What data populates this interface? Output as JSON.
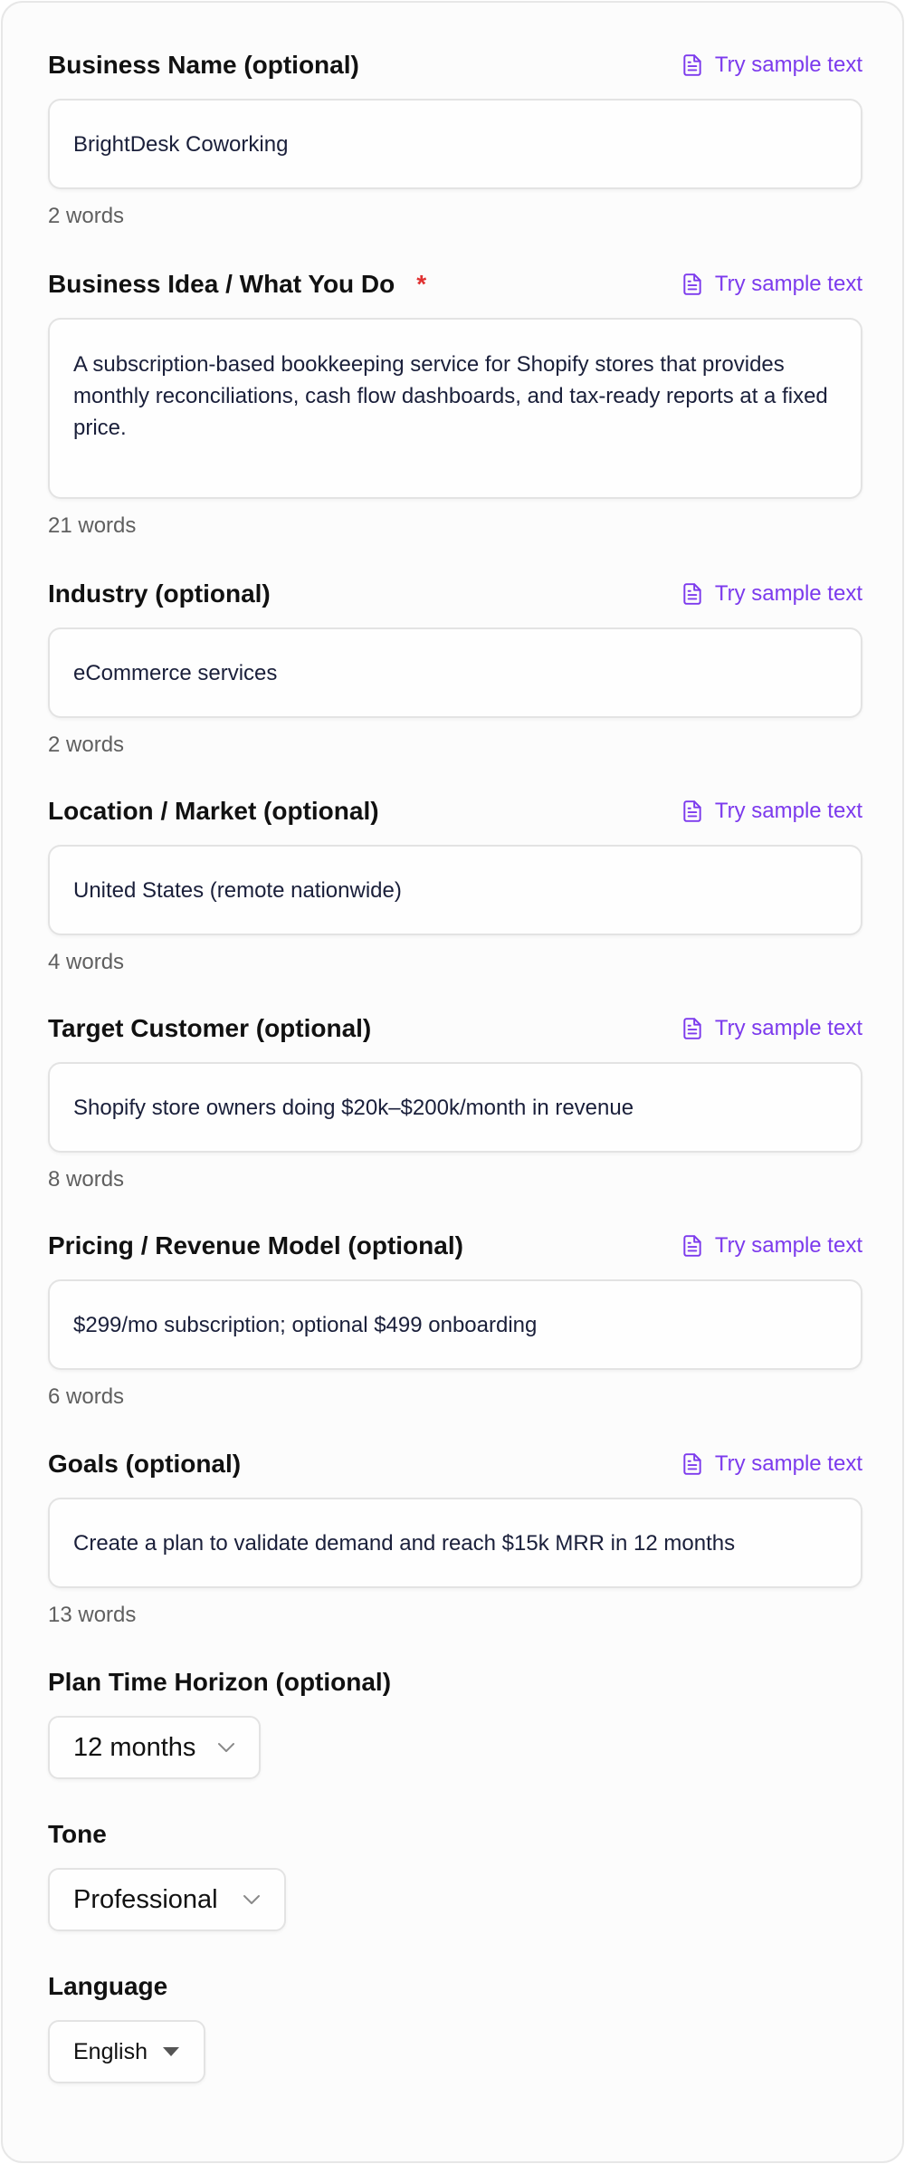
{
  "sample_label": "Try sample text",
  "fields": {
    "business_name": {
      "label": "Business Name (optional)",
      "value": "BrightDesk Coworking",
      "count": "2 words"
    },
    "business_idea": {
      "label": "Business Idea / What You Do",
      "required": "*",
      "value": "A subscription-based bookkeeping service for Shopify stores that provides monthly reconciliations, cash flow dashboards, and tax-ready reports at a fixed price.",
      "count": "21 words"
    },
    "industry": {
      "label": "Industry (optional)",
      "value": "eCommerce services",
      "count": "2 words"
    },
    "location": {
      "label": "Location / Market (optional)",
      "value": "United States (remote nationwide)",
      "count": "4 words"
    },
    "target_customer": {
      "label": "Target Customer (optional)",
      "value": "Shopify store owners doing $20k–$200k/month in revenue",
      "count": "8 words"
    },
    "pricing": {
      "label": "Pricing / Revenue Model (optional)",
      "value": "$299/mo subscription; optional $499 onboarding",
      "count": "6 words"
    },
    "goals": {
      "label": "Goals (optional)",
      "value": "Create a plan to validate demand and reach $15k MRR in 12 months",
      "count": "13 words"
    }
  },
  "selects": {
    "time_horizon": {
      "label": "Plan Time Horizon (optional)",
      "value": "12 months"
    },
    "tone": {
      "label": "Tone",
      "value": "Professional"
    },
    "language": {
      "label": "Language",
      "value": "English"
    }
  },
  "colors": {
    "accent": "#7c3aed",
    "required": "#e03131",
    "border": "#e3e3e3",
    "muted": "#5f5f5f"
  }
}
